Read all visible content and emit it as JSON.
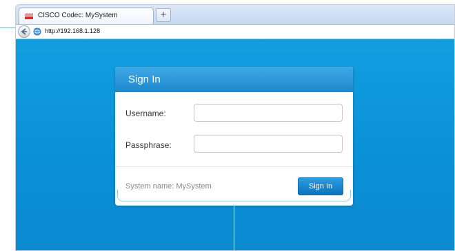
{
  "browser": {
    "tab_title": "CISCO Codec: MySystem",
    "new_tab_symbol": "+",
    "url": "http://192.168.1.128"
  },
  "dialog": {
    "title": "Sign In",
    "username_label": "Username:",
    "username_value": "",
    "passphrase_label": "Passphrase:",
    "passphrase_value": "",
    "system_name": "System name: MySystem",
    "signin_button": "Sign In"
  },
  "colors": {
    "page_background": "#0a8fd6",
    "dialog_header": "#2a96d8",
    "button": "#1a84cf"
  },
  "icons": {
    "tab_logo": "cisco-logo-icon",
    "back": "back-arrow-icon",
    "site": "globe-icon"
  }
}
